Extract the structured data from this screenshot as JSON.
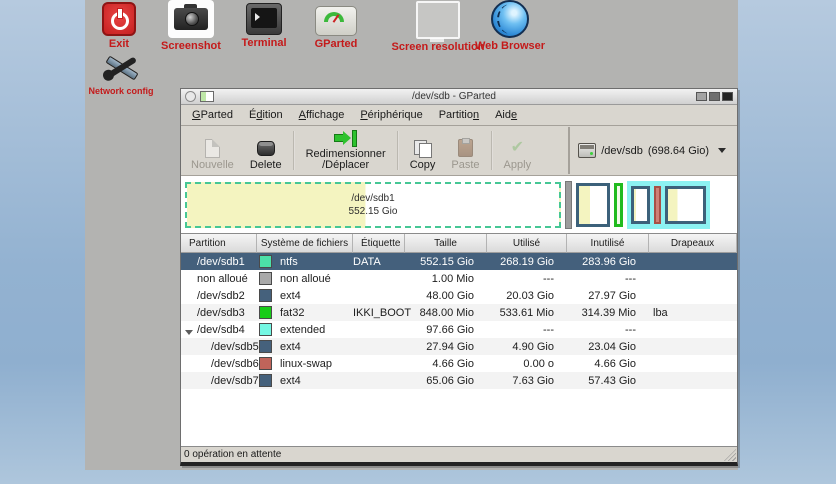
{
  "desktop": {
    "icons": [
      {
        "label": "Exit"
      },
      {
        "label": "Screenshot"
      },
      {
        "label": "Terminal"
      },
      {
        "label": "GParted"
      },
      {
        "label": "Screen resolution"
      },
      {
        "label": "Web Browser"
      },
      {
        "label": "Network config"
      }
    ]
  },
  "window": {
    "title": "/dev/sdb - GParted",
    "menu": [
      {
        "pre": "",
        "mn": "G",
        "post": "Parted"
      },
      {
        "pre": "É",
        "mn": "d",
        "post": "ition"
      },
      {
        "pre": "",
        "mn": "A",
        "post": "ffichage"
      },
      {
        "pre": "",
        "mn": "P",
        "post": "ériphérique"
      },
      {
        "pre": "Partitio",
        "mn": "n",
        "post": ""
      },
      {
        "pre": "Aid",
        "mn": "e",
        "post": ""
      }
    ],
    "toolbar": {
      "new_label": "Nouvelle",
      "delete_label": "Delete",
      "resize_label": "Redimensionner\n/Déplacer",
      "copy_label": "Copy",
      "paste_label": "Paste",
      "apply_label": "Apply",
      "device_selector": {
        "device": "/dev/sdb",
        "size": "(698.64 Gio)"
      }
    },
    "visual": {
      "selected_partition": "/dev/sdb1",
      "selected_size": "552.15 Gio"
    },
    "table": {
      "headers": [
        "Partition",
        "Système de fichiers",
        "Étiquette",
        "Taille",
        "Utilisé",
        "Inutilisé",
        "Drapeaux"
      ],
      "rows": [
        {
          "partition": "/dev/sdb1",
          "fs": "ntfs",
          "fs_color": "#4ce0a8",
          "label": "DATA",
          "size": "552.15 Gio",
          "used": "268.19 Gio",
          "unused": "283.96 Gio",
          "flags": ""
        },
        {
          "partition": "non alloué",
          "fs": "non alloué",
          "fs_color": "#a9a9a9",
          "label": "",
          "size": "1.00 Mio",
          "used": "---",
          "unused": "---",
          "flags": ""
        },
        {
          "partition": "/dev/sdb2",
          "fs": "ext4",
          "fs_color": "#45617c",
          "label": "",
          "size": "48.00 Gio",
          "used": "20.03 Gio",
          "unused": "27.97 Gio",
          "flags": ""
        },
        {
          "partition": "/dev/sdb3",
          "fs": "fat32",
          "fs_color": "#18cc18",
          "label": "IKKI_BOOT",
          "size": "848.00 Mio",
          "used": "533.61 Mio",
          "unused": "314.39 Mio",
          "flags": "lba"
        },
        {
          "partition": "/dev/sdb4",
          "fs": "extended",
          "fs_color": "#74f7e3",
          "label": "",
          "size": "97.66 Gio",
          "used": "---",
          "unused": "---",
          "flags": ""
        },
        {
          "partition": "/dev/sdb5",
          "fs": "ext4",
          "fs_color": "#45617c",
          "label": "",
          "size": "27.94 Gio",
          "used": "4.90 Gio",
          "unused": "23.04 Gio",
          "flags": ""
        },
        {
          "partition": "/dev/sdb6",
          "fs": "linux-swap",
          "fs_color": "#c0645a",
          "label": "",
          "size": "4.66 Gio",
          "used": "0.00 o",
          "unused": "4.66 Gio",
          "flags": ""
        },
        {
          "partition": "/dev/sdb7",
          "fs": "ext4",
          "fs_color": "#45617c",
          "label": "",
          "size": "65.06 Gio",
          "used": "7.63 Gio",
          "unused": "57.43 Gio",
          "flags": ""
        }
      ]
    },
    "statusbar": "0 opération en attente"
  },
  "colors": {
    "selection": "#44607c",
    "desktop_grey": "#b3b3b1",
    "window_bg": "#d9d6cf",
    "used_space": "#f4f4c0",
    "ntfs": "#4ce0a8",
    "ext4": "#45617c",
    "fat32": "#18cc18",
    "extended": "#74f7e3",
    "linux_swap": "#c0645a",
    "unallocated": "#a9a9a9"
  }
}
